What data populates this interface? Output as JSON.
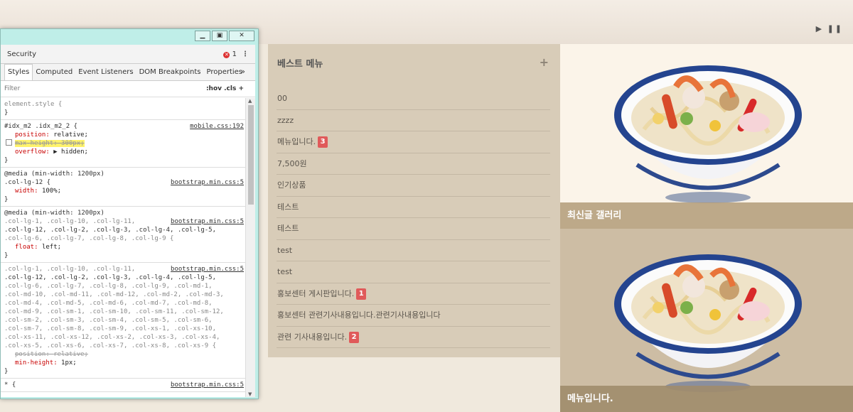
{
  "banner": {
    "controls": "▶ ❚❚"
  },
  "best_menu": {
    "title": "베스트 메뉴",
    "plus": "+",
    "items": [
      {
        "label": "00",
        "badge": ""
      },
      {
        "label": "zzzz",
        "badge": ""
      },
      {
        "label": "메뉴입니다.",
        "badge": "3"
      },
      {
        "label": "7,500원",
        "badge": ""
      },
      {
        "label": "인기상품",
        "badge": ""
      },
      {
        "label": "테스트",
        "badge": ""
      },
      {
        "label": "테스트",
        "badge": ""
      },
      {
        "label": "test",
        "badge": ""
      },
      {
        "label": "test",
        "badge": ""
      },
      {
        "label": "홍보센터 게시판입니다.",
        "badge": "1"
      },
      {
        "label": "홍보센터 관련기사내용입니다.관련기사내용입니다",
        "badge": ""
      },
      {
        "label": "관련 기사내용입니다.",
        "badge": "2"
      }
    ]
  },
  "gallery": {
    "tile1_caption": "최신글 갤러리",
    "tile2_caption": "메뉴입니다."
  },
  "devtools": {
    "security": "Security",
    "error_count": "1",
    "error_icon": "✕",
    "kebab": "⋮",
    "tabs": [
      "Styles",
      "Computed",
      "Event Listeners",
      "DOM Breakpoints",
      "Properties"
    ],
    "more": "»",
    "filter_placeholder": "Filter",
    "filter_tools": ":hov  .cls  +",
    "rules": {
      "r1_selector": "element.style {",
      "r2_selector": "#idx_m2 .idx_m2_2 {",
      "r2_src": "mobile.css:192",
      "r2_p1": "position",
      "r2_v1": "relative;",
      "r2_p2": "max-height",
      "r2_v2": "300px;",
      "r2_p3": "overflow",
      "r2_v3": "▶ hidden;",
      "r3_media": "@media (min-width: 1200px)",
      "r3_selector": ".col-lg-12 {",
      "r3_src": "bootstrap.min.css:5",
      "r3_p1": "width",
      "r3_v1": "100%;",
      "r4_media": "@media (min-width: 1200px)",
      "r4_sel_a": ".col-lg-1, .col-lg-10, .col-lg-11,",
      "r4_src": "bootstrap.min.css:5",
      "r4_sel_b": ".col-lg-12, .col-lg-2, .col-lg-3, .col-lg-4, .col-lg-5,",
      "r4_sel_c": ".col-lg-6, .col-lg-7, .col-lg-8, .col-lg-9 {",
      "r4_p1": "float",
      "r4_v1": "left;",
      "r5_sel_a": ".col-lg-1, .col-lg-10, .col-lg-11,",
      "r5_src": "bootstrap.min.css:5",
      "r5_sel_b": ".col-lg-12, .col-lg-2, .col-lg-3, .col-lg-4, .col-lg-5,",
      "r5_sel_c": ".col-lg-6, .col-lg-7, .col-lg-8, .col-lg-9, .col-md-1,",
      "r5_sel_d": ".col-md-10, .col-md-11, .col-md-12, .col-md-2, .col-md-3,",
      "r5_sel_e": ".col-md-4, .col-md-5, .col-md-6, .col-md-7, .col-md-8,",
      "r5_sel_f": ".col-md-9, .col-sm-1, .col-sm-10, .col-sm-11, .col-sm-12,",
      "r5_sel_g": ".col-sm-2, .col-sm-3, .col-sm-4, .col-sm-5, .col-sm-6,",
      "r5_sel_h": ".col-sm-7, .col-sm-8, .col-sm-9, .col-xs-1, .col-xs-10,",
      "r5_sel_i": ".col-xs-11, .col-xs-12, .col-xs-2, .col-xs-3, .col-xs-4,",
      "r5_sel_j": ".col-xs-5, .col-xs-6, .col-xs-7, .col-xs-8, .col-xs-9 {",
      "r5_p1": "position",
      "r5_v1": "relative;",
      "r5_p2": "min-height",
      "r5_v2": "1px;",
      "r6_selector": "* {",
      "r6_src": "bootstrap.min.css:5",
      "close": "}"
    }
  }
}
